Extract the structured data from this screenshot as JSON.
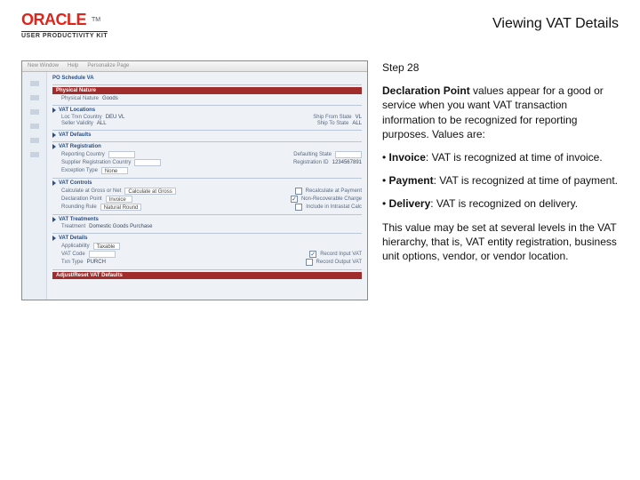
{
  "header": {
    "brand": "ORACLE",
    "tm": "TM",
    "kit": "USER PRODUCTIVITY KIT",
    "title": "Viewing VAT Details"
  },
  "step": "Step 28",
  "para1_lead": "Declaration Point",
  "para1_rest": " values appear for a good or service when you want VAT transaction information to be recognized for reporting purposes. Values are:",
  "bullets": [
    {
      "term": "Invoice",
      "text": ": VAT is recognized at time of invoice."
    },
    {
      "term": "Payment",
      "text": ": VAT is recognized at time of payment."
    },
    {
      "term": "Delivery",
      "text": ": VAT is recognized on delivery."
    }
  ],
  "para2": "This value may be set at several levels in the VAT hierarchy, that is, VAT entity registration, business unit options, vendor, or vendor location.",
  "app": {
    "menu": [
      "New Window",
      "Help",
      "Personalize Page"
    ],
    "win_title": "PO Schedule VA",
    "physical": {
      "hdr": "Physical Nature",
      "val": "Goods"
    },
    "locations": {
      "hdr": "VAT Locations",
      "loc_country_lbl": "Loc Trxn Country",
      "loc_country_val": "DEU VL",
      "loc_country2_lbl": "Seller Validity",
      "loc_country2_val": "ALL",
      "ship_from_lbl": "Ship From State",
      "ship_from_val": "VL",
      "ship_to_lbl": "Ship To State",
      "ship_to_val": "ALL"
    },
    "defaults": {
      "hdr": "VAT Defaults"
    },
    "registration": {
      "hdr": "VAT Registration",
      "reporting_lbl": "Reporting Country",
      "reporting_val": "",
      "def_ctry_lbl": "Defaulting State",
      "def_ctry_val": "",
      "supplier_reg_lbl": "Supplier Registration Country",
      "supplier_reg_val": "",
      "reg_id_lbl": "Registration ID",
      "reg_id_val": "1234567891",
      "exception_lbl": "Exception Type",
      "exception_val": "None"
    },
    "controls": {
      "hdr": "VAT Controls",
      "calc_lbl": "Calculate at Gross or Net",
      "calc_val": "Calculate at Gross",
      "recalc_lbl": "Recalculate at Payment",
      "rounding_lbl": "Rounding Rule",
      "rounding_val": "Natural Round",
      "nonrec_lbl": "Non-Recoverable Charge",
      "nonrec_chk": "✓",
      "intrastat_lbl": "Include in Intrastat Calc",
      "decl_lbl": "Declaration Point",
      "decl_val": "Invoice"
    },
    "treatments": {
      "hdr": "VAT Treatments",
      "trt_lbl": "Treatment",
      "trt_val": "Domestic Goods Purchase"
    },
    "details": {
      "hdr": "VAT Details",
      "applic_lbl": "Applicability",
      "applic_val": "Taxable",
      "code_lbl": "VAT Code",
      "code_val": "",
      "txn_lbl": "Txn Type",
      "txn_val": "PURCH",
      "record_in_lbl": "Record Input VAT",
      "record_in_chk": "✓",
      "record_out_lbl": "Record Output VAT"
    },
    "adjust": {
      "hdr": "Adjust/Reset VAT Defaults"
    }
  }
}
